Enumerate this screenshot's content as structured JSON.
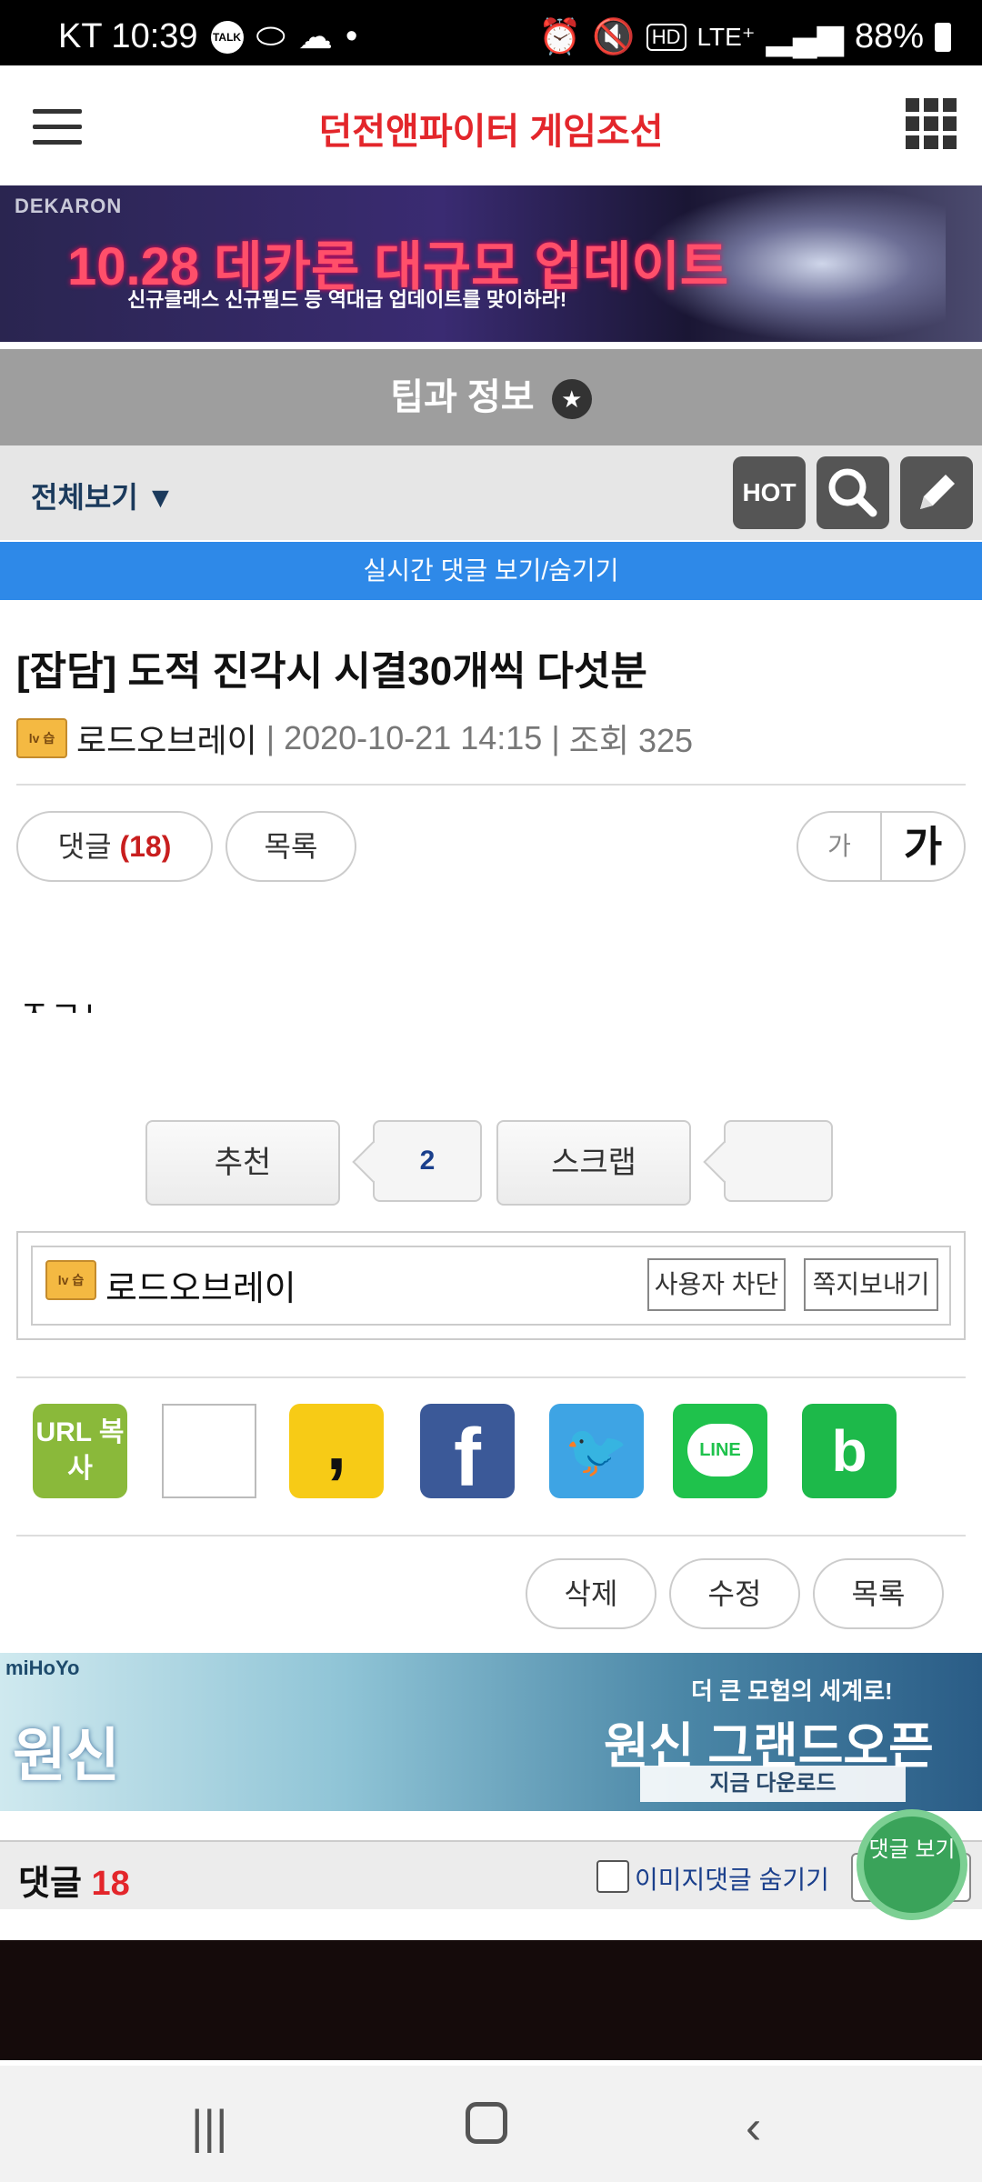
{
  "status_bar": {
    "carrier_time": "KT 10:39",
    "network": "LTE⁺",
    "battery": "88%"
  },
  "header": {
    "title": "던전앤파이터 게임조선"
  },
  "banner_top": {
    "brand": "DEKARON",
    "headline": "10.28 데카론 대규모 업데이트",
    "sub": "신규클래스 신규필드 등 역대급 업데이트를 맞이하라!"
  },
  "board": {
    "title": "팁과 정보",
    "view_all": "전체보기 ▼",
    "hot_label": "HOT",
    "live_comments": "실시간 댓글 보기/숨기기"
  },
  "post": {
    "title": "[잡담] 도적 진각시 시결30개씩 다섯분",
    "level_badge": "lv 습",
    "author": "로드오브레이",
    "date": "2020-10-21 14:15",
    "views": "조회 325",
    "body": "ㅈㄱㄴ"
  },
  "actions": {
    "comment_label": "댓글",
    "comment_count": "(18)",
    "list_label": "목록",
    "font_small": "가",
    "font_large": "가",
    "recommend_label": "추천",
    "recommend_count": "2",
    "scrap_label": "스크랩",
    "scrap_count": ""
  },
  "author_box": {
    "name": "로드오브레이",
    "block_label": "사용자 차단",
    "message_label": "쪽지보내기"
  },
  "share": {
    "url_copy": "URL 복사",
    "kakao": ",",
    "facebook": "f",
    "line": "LINE"
  },
  "manage": {
    "delete": "삭제",
    "edit": "수정",
    "list": "목록"
  },
  "banner_bottom": {
    "brand": "miHoYo",
    "logo": "원신",
    "tag": "더 큰 모험의 세계로!",
    "headline": "원신 그랜드오픈",
    "download": "지금 다운로드"
  },
  "comments": {
    "label": "댓글",
    "count": "18",
    "hide_image_label": "이미지댓글 숨기기",
    "float_button": "댓글 보기"
  },
  "colors": {
    "accent_red": "#e3262b",
    "live_bar": "#2e89e8",
    "board_title_bg": "#9e9e9e"
  }
}
